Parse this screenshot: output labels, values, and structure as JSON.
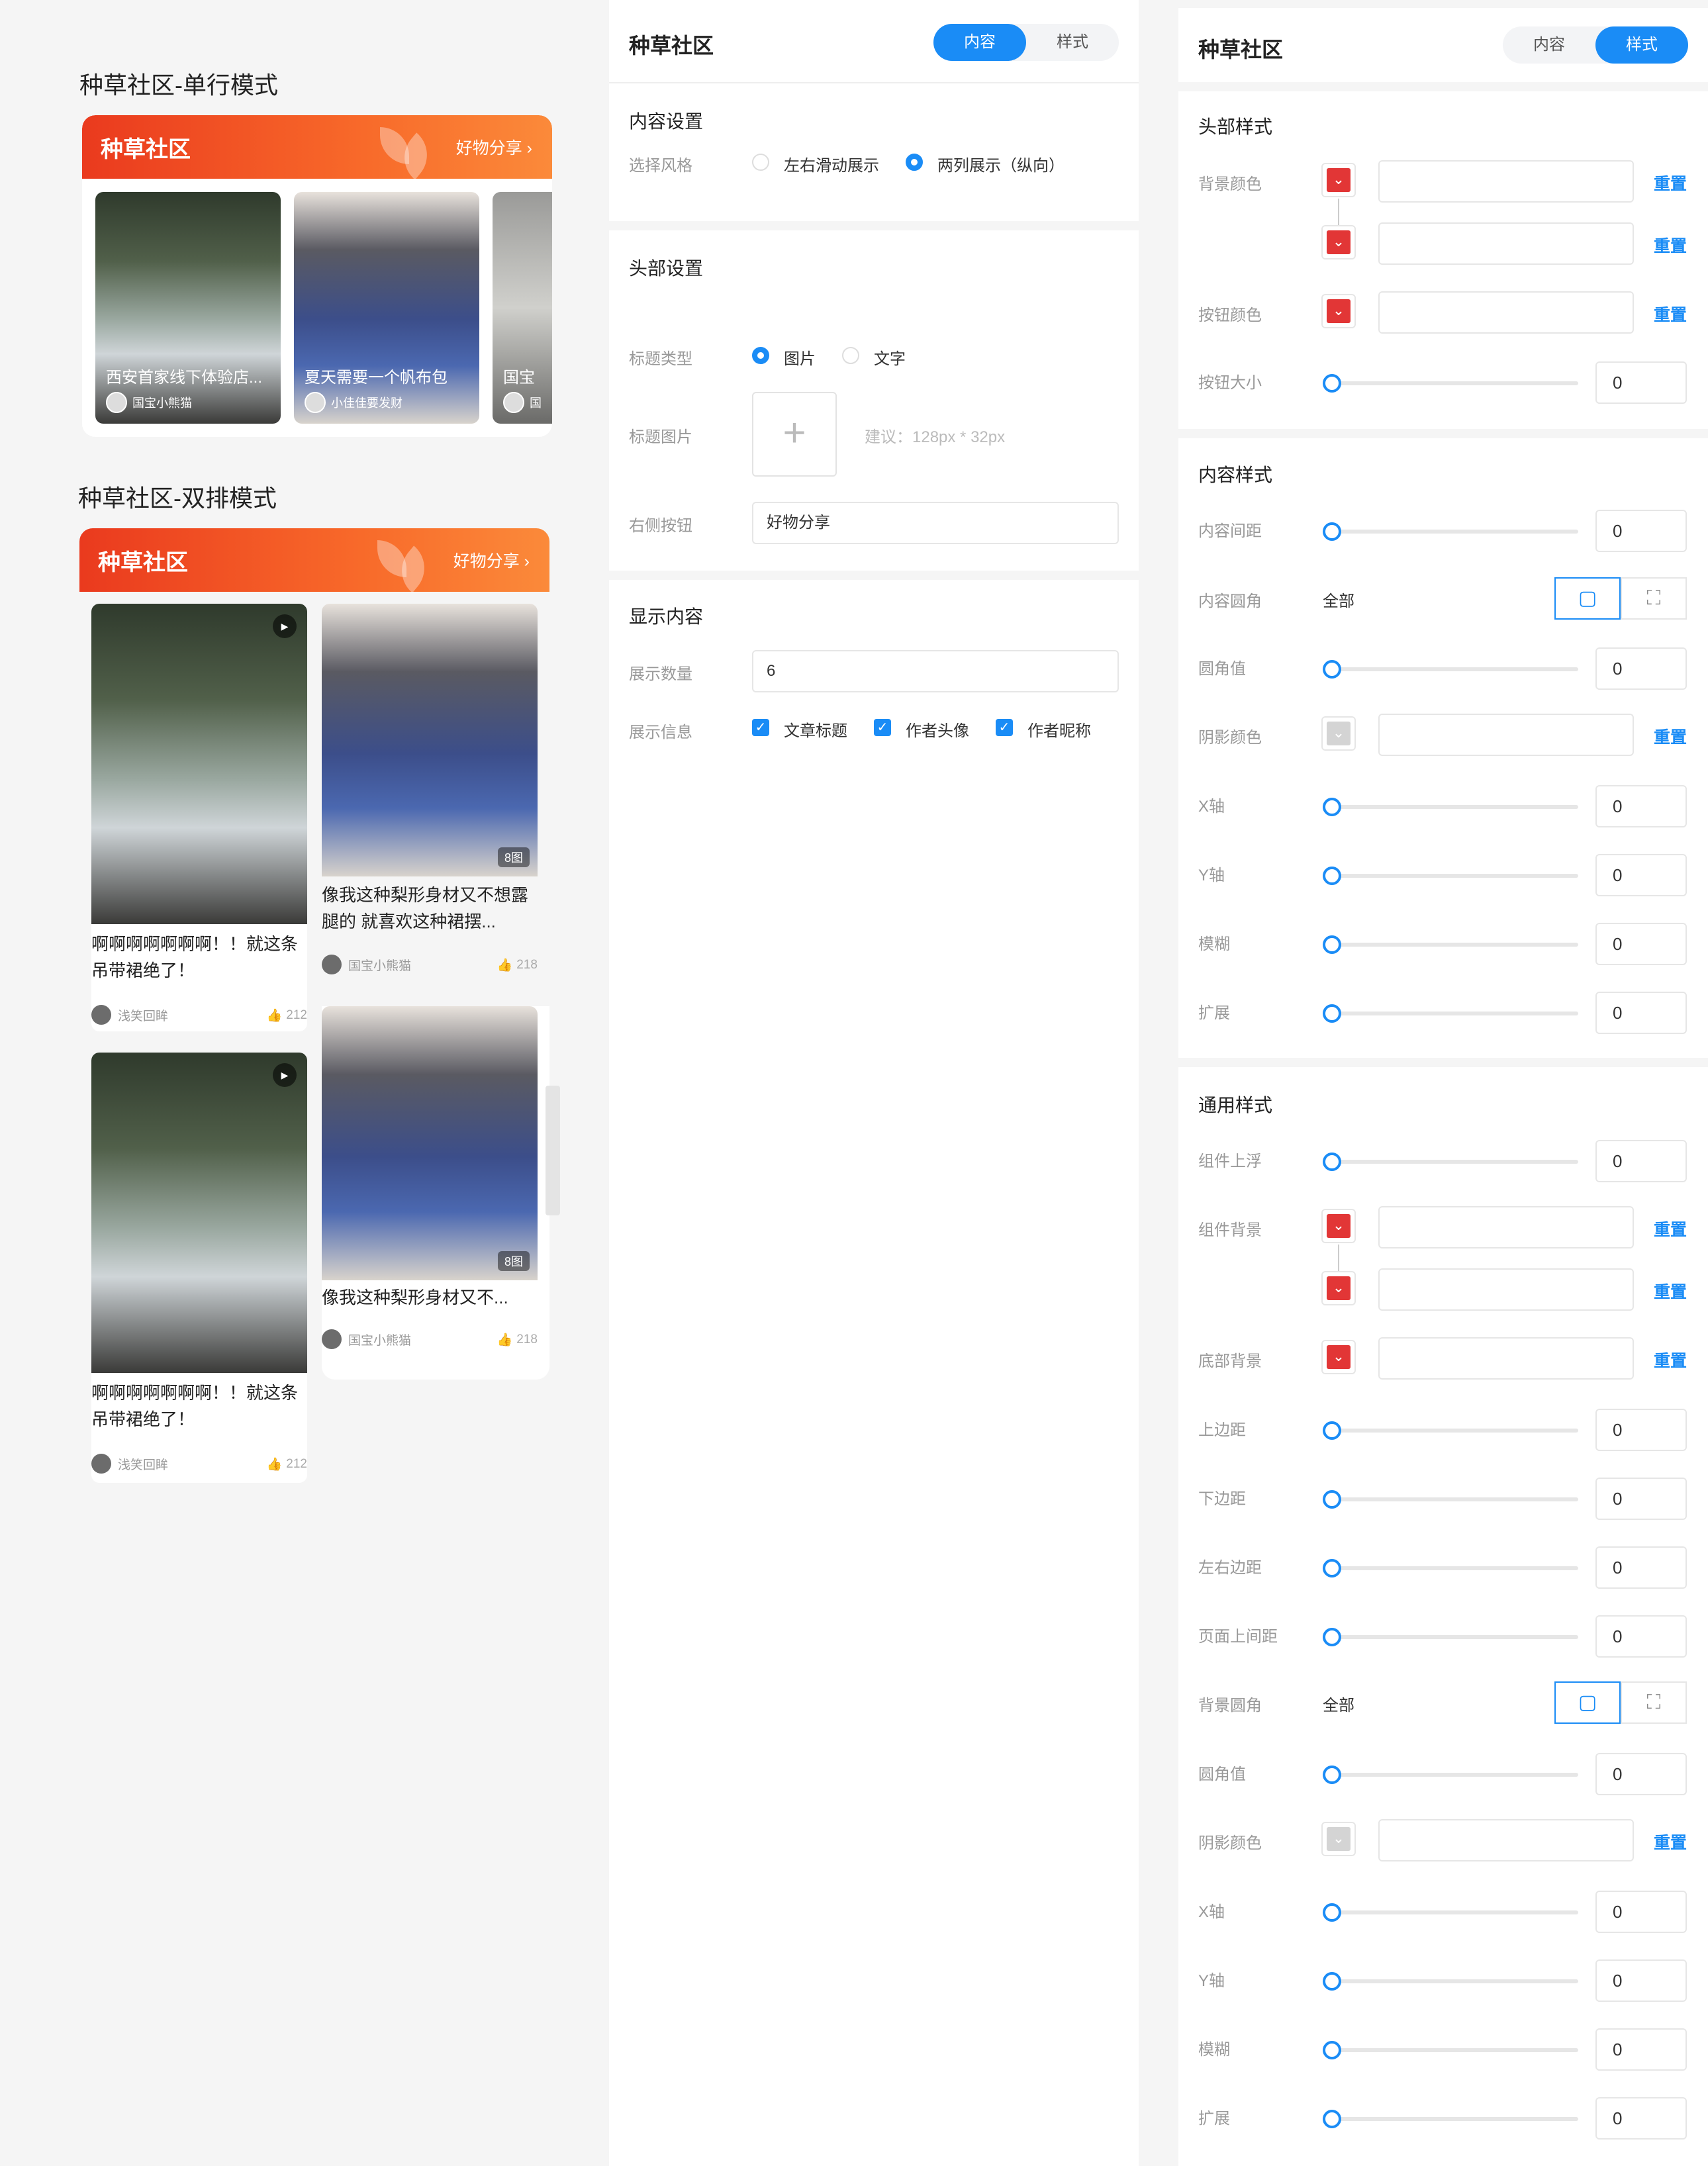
{
  "preview": {
    "single_title": "种草社区-单行模式",
    "double_title": "种草社区-双排模式",
    "header_title": "种草社区",
    "header_more": "好物分享",
    "single_items": [
      {
        "title": "西安首家线下体验店...",
        "author": "国宝小熊猫"
      },
      {
        "title": "夏天需要一个帆布包",
        "author": "小佳佳要发财"
      },
      {
        "title": "国宝",
        "author": "国"
      }
    ],
    "double_items": [
      {
        "title_l1": "啊啊啊啊啊啊啊！！就这条",
        "title_l2": "吊带裙绝了！",
        "author": "浅笑回眸",
        "likes": "212"
      },
      {
        "title_l1": "像我这种梨形身材又不想露",
        "title_l2": "腿的 就喜欢这种裙摆...",
        "author": "国宝小熊猫",
        "likes": "218",
        "badge": "8图"
      },
      {
        "title_l1": "啊啊啊啊啊啊啊！！就这条",
        "title_l2": "吊带裙绝了！",
        "author": "浅笑回眸",
        "likes": "212"
      },
      {
        "title_l1": "像我这种梨形身材又不...",
        "title_l2": "",
        "author": "国宝小熊猫",
        "likes": "218",
        "badge": "8图"
      }
    ]
  },
  "content_panel": {
    "title": "种草社区",
    "tab_content": "内容",
    "tab_style": "样式",
    "content_settings": {
      "heading": "内容设置",
      "style_label": "选择风格",
      "opt_scroll": "左右滑动展示",
      "opt_two_col": "两列展示（纵向）"
    },
    "header_settings": {
      "heading": "头部设置",
      "title_type_label": "标题类型",
      "opt_image": "图片",
      "opt_text": "文字",
      "title_image_label": "标题图片",
      "upload_plus": "+",
      "hint": "建议：128px * 32px",
      "right_button_label": "右侧按钮",
      "right_button_value": "好物分享"
    },
    "display": {
      "heading": "显示内容",
      "count_label": "展示数量",
      "count_value": "6",
      "info_label": "展示信息",
      "opt_title": "文章标题",
      "opt_avatar": "作者头像",
      "opt_nickname": "作者昵称"
    }
  },
  "style_panel": {
    "title": "种草社区",
    "tab_content": "内容",
    "tab_style": "样式",
    "reset": "重置",
    "all": "全部",
    "header_style": {
      "heading": "头部样式",
      "bg_color": "背景颜色",
      "btn_color": "按钮颜色",
      "btn_size": "按钮大小",
      "btn_size_value": "0"
    },
    "content_style": {
      "heading": "内容样式",
      "spacing": "内容间距",
      "spacing_value": "0",
      "radius": "内容圆角",
      "radius_value_label": "圆角值",
      "radius_value": "0",
      "shadow_color": "阴影颜色",
      "x": "X轴",
      "x_value": "0",
      "y": "Y轴",
      "y_value": "0",
      "blur": "模糊",
      "blur_value": "0",
      "spread": "扩展",
      "spread_value": "0"
    },
    "common_style": {
      "heading": "通用样式",
      "float_up": "组件上浮",
      "float_up_value": "0",
      "bg": "组件背景",
      "bottom_bg": "底部背景",
      "margin_top": "上边距",
      "margin_top_value": "0",
      "margin_bottom": "下边距",
      "margin_bottom_value": "0",
      "margin_lr": "左右边距",
      "margin_lr_value": "0",
      "page_gap": "页面上间距",
      "page_gap_value": "0",
      "bg_radius": "背景圆角",
      "radius_value_label": "圆角值",
      "radius_value": "0",
      "shadow_color": "阴影颜色",
      "x": "X轴",
      "x_value": "0",
      "y": "Y轴",
      "y_value": "0",
      "blur": "模糊",
      "blur_value": "0",
      "spread": "扩展",
      "spread_value": "0"
    }
  },
  "colors": {
    "accent": "#1a8cf6",
    "brand_orange": "#f3562a",
    "swatch_red": "#e23636"
  },
  "icons": [
    "chevron-right-icon",
    "leaf-logo-icon",
    "play-icon",
    "like-icon",
    "plus-icon",
    "check-icon",
    "chevron-down-icon",
    "square-radius-icon",
    "expand-corners-icon"
  ]
}
